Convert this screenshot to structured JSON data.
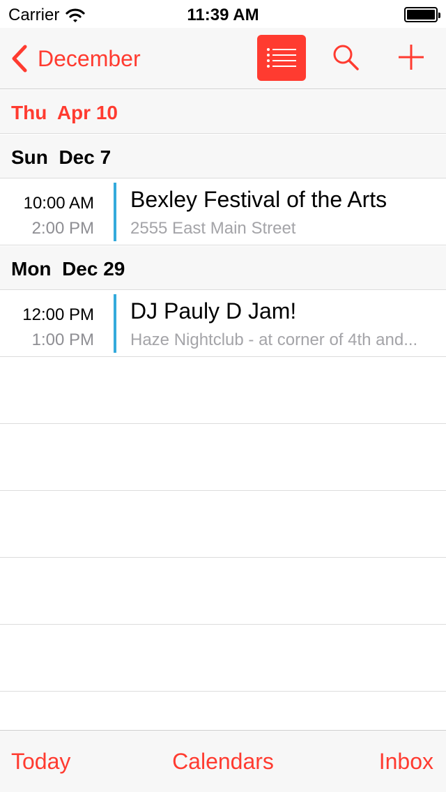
{
  "status_bar": {
    "carrier": "Carrier",
    "time": "11:39 AM",
    "wifi_icon": "wifi-icon",
    "battery_icon": "battery-icon"
  },
  "nav": {
    "back_label": "December",
    "accent_color": "#ff3b30",
    "list_icon": "list-icon",
    "search_icon": "search-icon",
    "add_icon": "plus-icon"
  },
  "today": {
    "label": "Thu  Apr 10"
  },
  "days": [
    {
      "label": "Sun  Dec 7",
      "events": [
        {
          "start": "10:00 AM",
          "end": "2:00 PM",
          "title": "Bexley Festival of the Arts",
          "location": "2555 East Main Street",
          "calendar_color": "#34aadc"
        }
      ]
    },
    {
      "label": "Mon  Dec 29",
      "events": [
        {
          "start": "12:00 PM",
          "end": "1:00 PM",
          "title": "DJ Pauly D Jam!",
          "location": "Haze Nightclub - at corner of 4th and...",
          "calendar_color": "#34aadc"
        }
      ]
    }
  ],
  "toolbar": {
    "today_label": "Today",
    "calendars_label": "Calendars",
    "inbox_label": "Inbox"
  }
}
